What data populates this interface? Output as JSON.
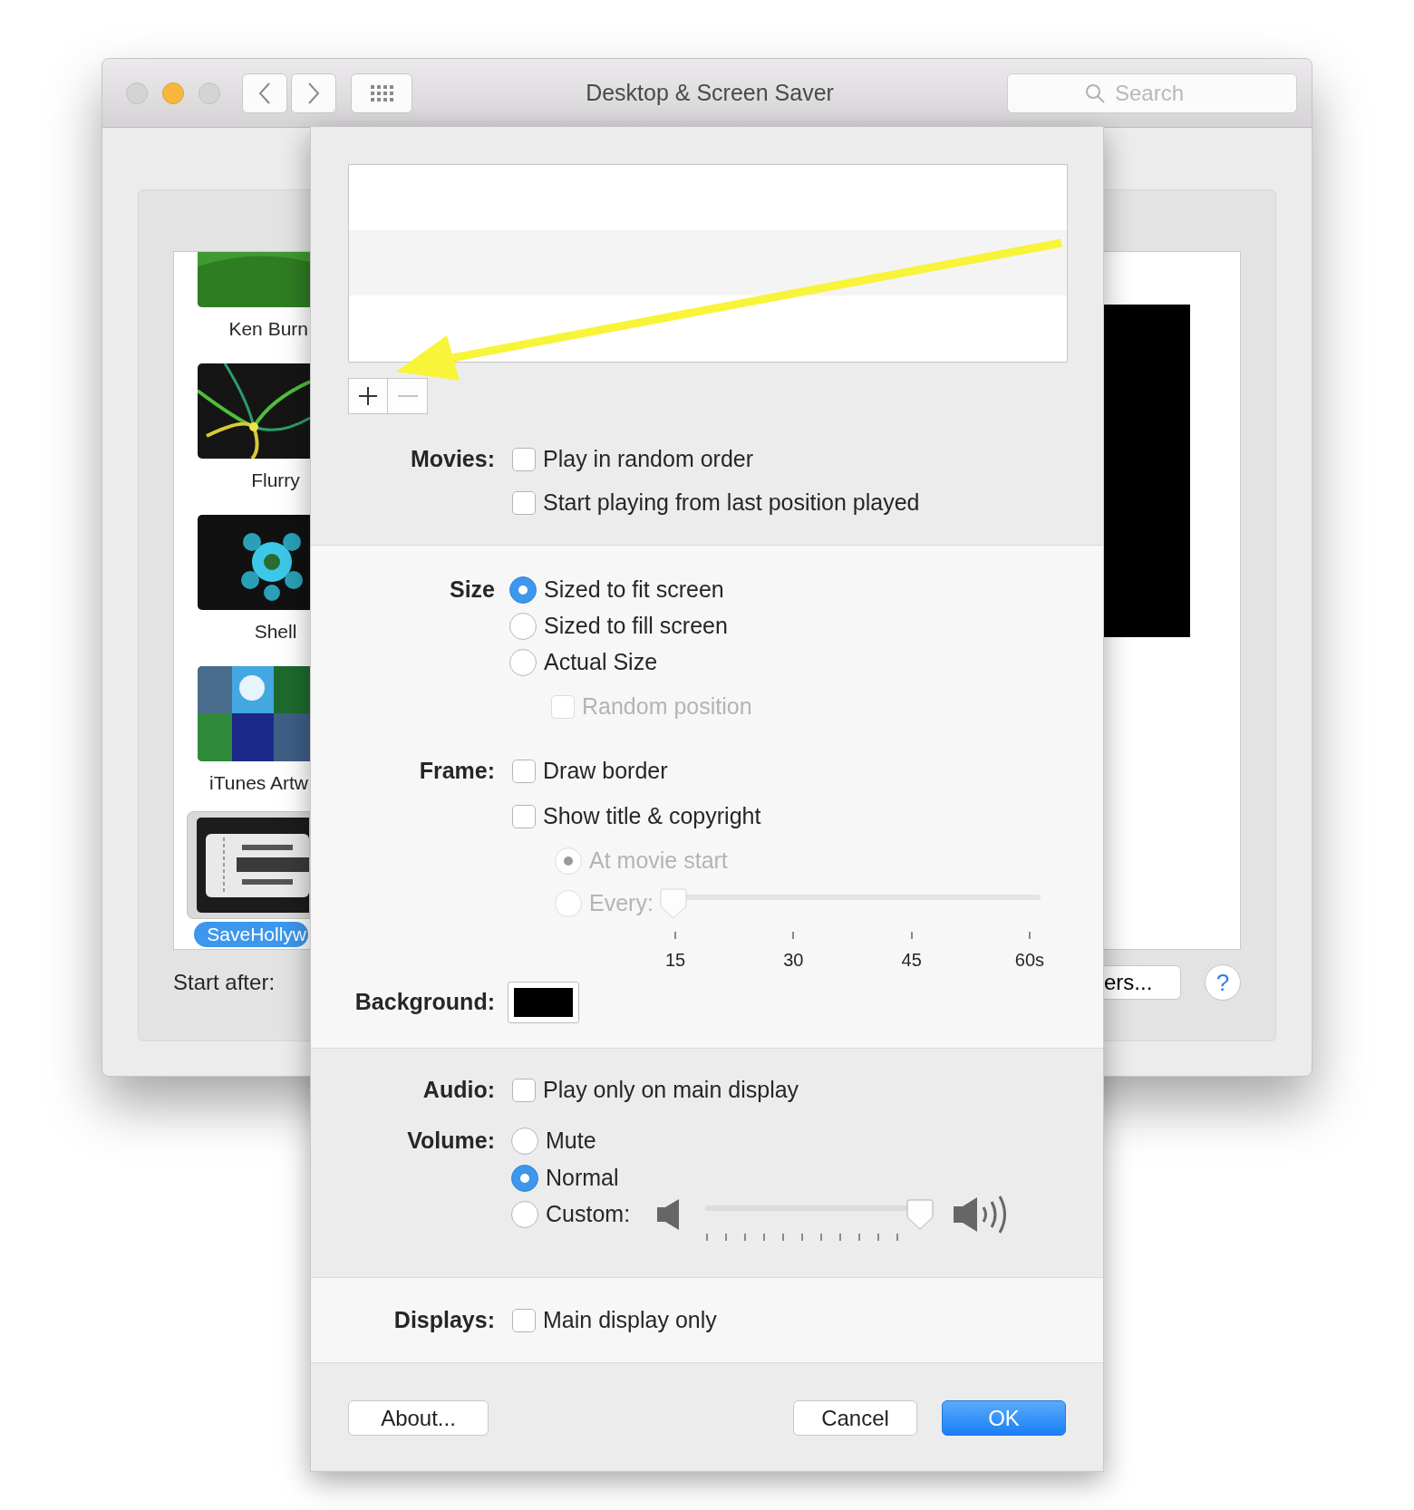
{
  "window": {
    "title": "Desktop & Screen Saver",
    "search": {
      "placeholder": "Search"
    }
  },
  "screen_savers": [
    {
      "label": "Ken Burn",
      "kind": "meadow",
      "selected": false
    },
    {
      "label": "Flurry",
      "kind": "ribbons",
      "selected": false
    },
    {
      "label": "Shell",
      "kind": "flower",
      "selected": false
    },
    {
      "label": "iTunes Artw",
      "kind": "mosaic",
      "selected": false
    },
    {
      "label": "SaveHollyw",
      "kind": "ticket",
      "selected": true
    }
  ],
  "start_after": {
    "label": "Start after:"
  },
  "corners_button": "ers...",
  "help_button": "?",
  "sheet": {
    "movies": {
      "label": "Movies:",
      "options": [
        {
          "label": "Play in random order",
          "checked": false
        },
        {
          "label": "Start playing from last position played",
          "checked": false
        }
      ]
    },
    "size": {
      "label": "Size",
      "options": [
        {
          "label": "Sized to fit screen",
          "selected": true
        },
        {
          "label": "Sized to fill screen",
          "selected": false
        },
        {
          "label": "Actual Size",
          "selected": false
        }
      ],
      "random_position": {
        "label": "Random position",
        "checked": false,
        "disabled": true
      }
    },
    "frame": {
      "label": "Frame:",
      "options": [
        {
          "label": "Draw border",
          "checked": false
        },
        {
          "label": "Show title & copyright",
          "checked": false
        }
      ],
      "timing": [
        {
          "label": "At movie start",
          "selected": true,
          "disabled": true
        },
        {
          "label": "Every:",
          "selected": false,
          "disabled": true
        }
      ],
      "interval": {
        "level": 0,
        "disabled": true,
        "ticks": [
          "15",
          "30",
          "45",
          "60s"
        ]
      }
    },
    "background": {
      "label": "Background:",
      "color": "#000000"
    },
    "audio": {
      "label": "Audio:",
      "option": {
        "label": "Play only on main display",
        "checked": false
      }
    },
    "volume": {
      "label": "Volume:",
      "options": [
        {
          "label": "Mute",
          "selected": false
        },
        {
          "label": "Normal",
          "selected": true
        },
        {
          "label": "Custom:",
          "selected": false
        }
      ],
      "slider": {
        "level": 1
      }
    },
    "displays": {
      "label": "Displays:",
      "option": {
        "label": "Main display only",
        "checked": false
      }
    },
    "buttons": [
      {
        "label": "About...",
        "kind": "default"
      },
      {
        "label": "Cancel",
        "kind": "default"
      },
      {
        "label": "OK",
        "kind": "primary"
      }
    ]
  }
}
